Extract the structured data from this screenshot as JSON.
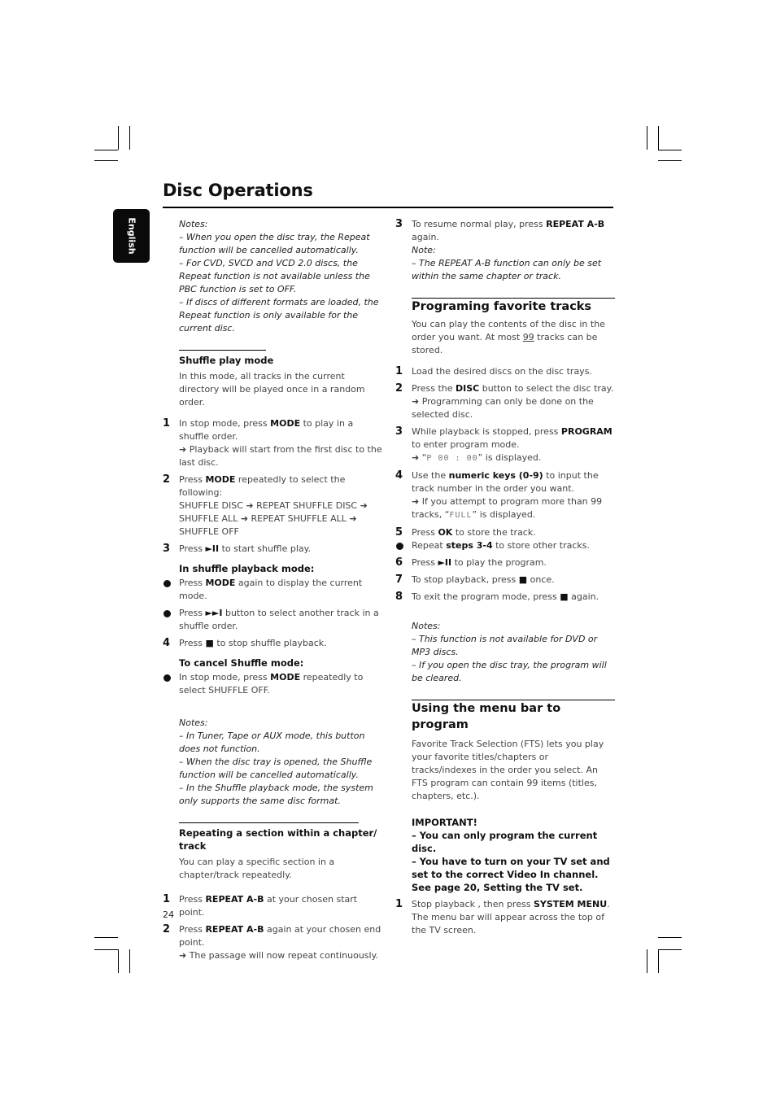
{
  "page": {
    "title": "Disc Operations",
    "language_tab": "English",
    "page_number": "24"
  },
  "left": {
    "notes1": {
      "heading": "Notes:",
      "items": [
        "–  When you open the disc tray, the Repeat function will be cancelled automatically.",
        "–  For CVD, SVCD and VCD 2.0 discs, the Repeat function is not available unless the PBC function is set to OFF.",
        "–  If discs of different formats are loaded, the Repeat function is only available for the current disc."
      ]
    },
    "shuffle": {
      "heading": "Shuffle play mode",
      "intro": "In this mode, all tracks in the current directory will be played once in a random order.",
      "step1": {
        "num": "1",
        "pre": "In stop mode, press ",
        "bold": "MODE",
        "post": " to play in a shuffle order.",
        "result": "➜ Playback will start from the first disc to the last disc."
      },
      "step2": {
        "num": "2",
        "pre": "Press ",
        "bold": "MODE",
        "post": " repeatedly to select the following:",
        "sequence": "SHUFFLE DISC ➜ REPEAT SHUFFLE DISC ➜ SHUFFLE ALL ➜ REPEAT SHUFFLE ALL ➜ SHUFFLE OFF"
      },
      "step3": {
        "num": "3",
        "pre": "Press ",
        "icon": "►II",
        "post": " to start shuffle play."
      },
      "playback_heading": "In shuffle playback mode:",
      "bullet1": {
        "pre": "Press ",
        "bold": "MODE",
        "post": " again to display the current mode."
      },
      "bullet2": {
        "pre": "Press ",
        "icon": "►►I",
        "post": " button to select another track in a shuffle order."
      },
      "step4": {
        "num": "4",
        "pre": "Press ",
        "icon": "■",
        "post": " to stop shuffle playback."
      },
      "cancel_heading": "To cancel Shuffle mode:",
      "bullet3": {
        "pre": "In stop mode, press ",
        "bold": "MODE",
        "post": " repeatedly to select SHUFFLE OFF."
      }
    },
    "notes2": {
      "heading": "Notes:",
      "items": [
        "–  In Tuner, Tape or AUX mode, this button does not function.",
        "–  When the disc tray is opened, the Shuffle function will be cancelled automatically.",
        "–  In the Shuffle playback mode, the system only supports the same disc format."
      ]
    },
    "repeat_ab": {
      "heading": "Repeating a section within a chapter/ track",
      "intro": "You can play a specific section in a chapter/track repeatedly.",
      "step1": {
        "num": "1",
        "pre": "Press ",
        "bold": "REPEAT A-B",
        "post": " at your chosen start point."
      },
      "step2": {
        "num": "2",
        "pre": "Press ",
        "bold": "REPEAT A-B",
        "post": " again at your chosen end point.",
        "result": "➜ The passage will now repeat continuously."
      }
    }
  },
  "right": {
    "repeat_ab_step3": {
      "num": "3",
      "pre": "To resume normal play, press ",
      "bold": "REPEAT A-B",
      "post": " again."
    },
    "repeat_note": {
      "heading": "Note:",
      "item": "–  The REPEAT A-B function can only be set within the same chapter or track."
    },
    "programming": {
      "heading": "Programing favorite tracks",
      "intro_pre": "You can play the contents of the disc in the order you want. At most ",
      "intro_num": "99",
      "intro_post": " tracks can be stored.",
      "step1": {
        "num": "1",
        "text": "Load the desired discs on the disc trays."
      },
      "step2": {
        "num": "2",
        "pre": "Press the ",
        "bold": "DISC",
        "post": " button to select the disc tray.",
        "result": "➜ Programming can only be done on the selected disc."
      },
      "step3": {
        "num": "3",
        "pre": "While playback is stopped, press ",
        "bold": "PROGRAM",
        "post": " to enter program mode.",
        "result_pre": "➜ “",
        "lcd": "P 00 : 00",
        "result_post": "” is displayed."
      },
      "step4": {
        "num": "4",
        "pre": "Use the ",
        "bold": "numeric keys (0-9)",
        "post": " to input the track number in the order you want.",
        "result_pre": "➜ If you attempt to program more than 99 tracks, “",
        "lcd": "FULL",
        "result_post": "” is displayed."
      },
      "step5": {
        "num": "5",
        "pre": "Press ",
        "bold": "OK",
        "post": " to store the track."
      },
      "bullet": {
        "pre": "Repeat ",
        "bold": "steps 3-4",
        "post": " to store other tracks."
      },
      "step6": {
        "num": "6",
        "pre": "Press ",
        "icon": "►II",
        "post": " to play the program."
      },
      "step7": {
        "num": "7",
        "pre": "To stop playback, press ",
        "icon": "■",
        "post": " once."
      },
      "step8": {
        "num": "8",
        "pre": "To exit the program mode, press ",
        "icon": "■",
        "post": " again."
      }
    },
    "notes3": {
      "heading": "Notes:",
      "items": [
        "–  This function is not available for DVD or MP3 discs.",
        "–  If you open the disc tray, the program will be cleared."
      ]
    },
    "menu_bar": {
      "heading": "Using the menu bar to program",
      "intro": "Favorite Track Selection (FTS) lets you play your favorite titles/chapters or tracks/indexes in the order you select. An FTS program can contain 99 items (titles, chapters, etc.).",
      "important_heading": "IMPORTANT!",
      "important_items": [
        "–  You can only program the current disc.",
        "–  You have to turn on your TV set and set to the correct Video In channel.  See page 20, Setting the TV set."
      ],
      "step1": {
        "num": "1",
        "pre": "Stop playback , then press ",
        "bold": "SYSTEM MENU",
        "post": ".",
        "result": "The menu bar will appear across the top of the TV screen."
      }
    }
  }
}
